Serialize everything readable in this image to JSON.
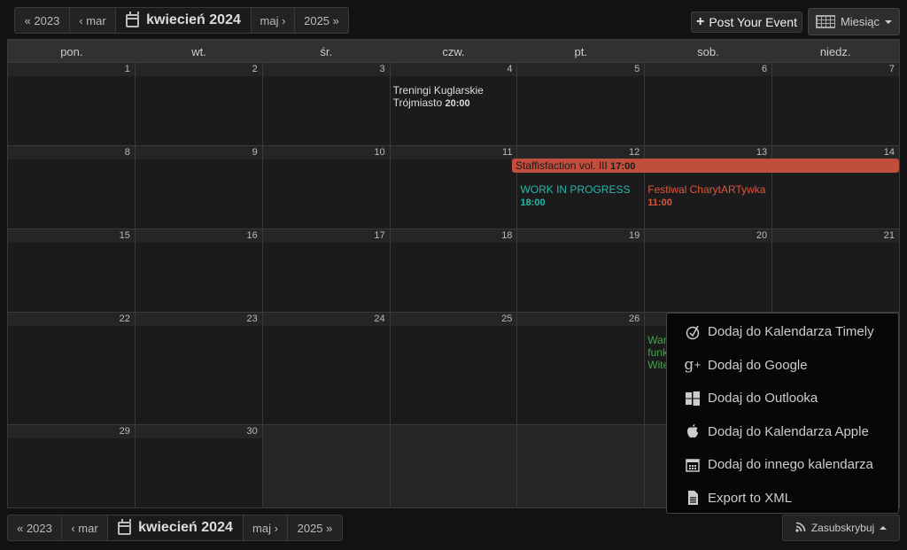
{
  "nav": {
    "prev_year": "« 2023",
    "prev_month": "‹ mar",
    "current": "kwiecień 2024",
    "next_month": "maj ›",
    "next_year": "2025 »"
  },
  "toolbar": {
    "post_event": "Post Your Event",
    "view_label": "Miesiąc"
  },
  "weekdays": [
    "pon.",
    "wt.",
    "śr.",
    "czw.",
    "pt.",
    "sob.",
    "niedz."
  ],
  "weeks": [
    [
      "1",
      "2",
      "3",
      "4",
      "5",
      "6",
      "7"
    ],
    [
      "8",
      "9",
      "10",
      "11",
      "12",
      "13",
      "14"
    ],
    [
      "15",
      "16",
      "17",
      "18",
      "19",
      "20",
      "21"
    ],
    [
      "22",
      "23",
      "24",
      "25",
      "26",
      "",
      ""
    ],
    [
      "29",
      "30",
      "",
      "",
      "",
      "",
      ""
    ]
  ],
  "events": {
    "treningi_title": "Treningi Kuglarskie Trójmiasto",
    "treningi_time": "20:00",
    "staffis_title": "Staffisfaction vol. III",
    "staffis_time": "17:00",
    "wip_title": "WORK IN PROGRESS",
    "wip_time": "18:00",
    "festiwal_title": "Festiwal CharytARTywka",
    "festiwal_time": "11:00",
    "partial_line1": "War",
    "partial_line2": "funk",
    "partial_line3": "Wite"
  },
  "subscribe_menu": {
    "items": [
      {
        "label": "Dodaj do Kalendarza Timely",
        "icon": "timely-icon"
      },
      {
        "label": "Dodaj do Google",
        "icon": "google-plus-icon"
      },
      {
        "label": "Dodaj do Outlooka",
        "icon": "windows-icon"
      },
      {
        "label": "Dodaj do Kalendarza Apple",
        "icon": "apple-icon"
      },
      {
        "label": "Dodaj do innego kalendarza",
        "icon": "calendar-icon"
      },
      {
        "label": "Export to XML",
        "icon": "file-icon"
      }
    ]
  },
  "subscribe_button": "Zasubskrybuj",
  "colors": {
    "event_red": "#c14d3c",
    "event_teal": "#2ab5a8",
    "event_green": "#41a54a"
  }
}
